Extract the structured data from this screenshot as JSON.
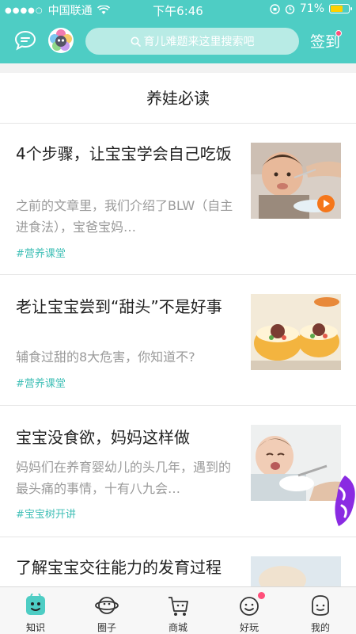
{
  "status_bar": {
    "carrier": "中国联通",
    "time": "下午6:46",
    "battery": "71%",
    "battery_level": 0.71
  },
  "header": {
    "search_placeholder": "育儿难题来这里搜索吧",
    "signin_label": "签到",
    "chat_icon": "chat-bubble-icon",
    "avatar_icon": "user-avatar-icon",
    "accent_color": "#4ecdc4"
  },
  "section": {
    "title": "养娃必读"
  },
  "articles": [
    {
      "title": "4个步骤，让宝宝学会自己吃饭",
      "desc": "之前的文章里，我们介绍了BLW（自主进食法），宝爸宝妈…",
      "tag": "#营养课堂",
      "thumb": "baby-eating-photo",
      "has_video": true
    },
    {
      "title": "老让宝宝尝到“甜头”不是好事",
      "desc": "辅食过甜的8大危害，你知道不?",
      "tag": "#营养课堂",
      "thumb": "sweet-cupcakes-photo",
      "has_video": false
    },
    {
      "title": "宝宝没食欲，妈妈这样做",
      "desc": "妈妈们在养育婴幼儿的头几年，遇到的最头痛的事情，十有八九会…",
      "tag": "#宝宝树开讲",
      "thumb": "crying-baby-photo",
      "has_video": false
    },
    {
      "title": "了解宝宝交往能力的发育过程",
      "desc": "",
      "tag": "",
      "thumb": "baby-photo",
      "has_video": false
    }
  ],
  "tabbar": [
    {
      "label": "知识",
      "icon": "knowledge-icon",
      "active": true
    },
    {
      "label": "圈子",
      "icon": "circle-planet-icon",
      "active": false
    },
    {
      "label": "商城",
      "icon": "shop-cart-icon",
      "active": false
    },
    {
      "label": "好玩",
      "icon": "fun-face-icon",
      "active": false,
      "badge": true
    },
    {
      "label": "我的",
      "icon": "profile-face-icon",
      "active": false
    }
  ]
}
